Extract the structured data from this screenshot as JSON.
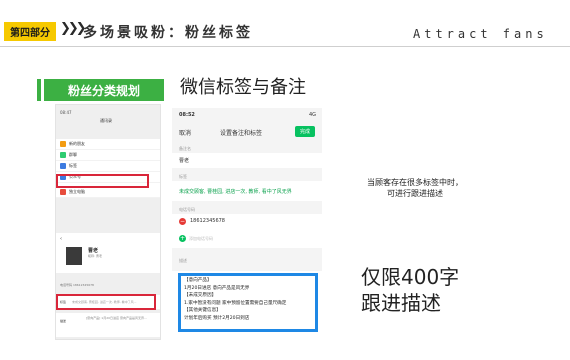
{
  "header": {
    "badge": "第四部分",
    "chevrons": "❯❯❯",
    "title": "多场景吸粉：粉丝标签",
    "subtitle_en": "Attract fans"
  },
  "section_label": "粉丝分类规划",
  "slide_title": "微信标签与备注",
  "phone_left": {
    "status_time": "08:47",
    "title": "通讯录",
    "menu": [
      {
        "label": "新的朋友",
        "color": "#f39c12"
      },
      {
        "label": "群聊",
        "color": "#2ecc71"
      },
      {
        "label": "标签",
        "color": "#3d7be0"
      },
      {
        "label": "公众号",
        "color": "#3d7be0"
      }
    ],
    "extra_item": "独立电脑",
    "back": "‹",
    "contact_name": "曹老",
    "contact_sub": "昵称: 曹老",
    "phone_label": "电话号码 18612345678",
    "tags_label": "标签",
    "tags": [
      "未成交顾客, 曹桂园, 进店一次, 教师, 看中了风..."
    ],
    "desc_label": "描述",
    "desc_text": "[意向产品] 1月20日进店 意向产品是风无界..."
  },
  "phone_right": {
    "status_time": "08:52",
    "status_right": "4G",
    "cancel": "取消",
    "nav_title": "设置备注和标签",
    "done": "完成",
    "remark_label": "备注名",
    "remark_value": "曹老",
    "tag_label": "标签",
    "tag_value": "未成交顾客, 曹桂园, 进店一次, 教师, 看中了风无界",
    "phone_label": "电话号码",
    "phone_value": "18612345678",
    "add_phone": "添加电话号码",
    "desc_label": "描述",
    "desc_lines": [
      "【意向产品】",
      "1月20日进店 意向产品是风无界",
      "【未成交原因】",
      "1.家中暂没有问题 家中预留位置需要自己量尺确定",
      "【其他关键信息】",
      "计划年后购买 预计2月20日到店"
    ]
  },
  "note_lines": [
    "当顾客存在很多标签中时，",
    "可进行跟进描述"
  ],
  "big_lines": [
    "仅限400字",
    "跟进描述"
  ],
  "colors": {
    "badge": "#f6c900",
    "green": "#3cb043",
    "highlight_red": "#d9263a",
    "highlight_blue": "#1e88e5",
    "wechat_green": "#07c160"
  }
}
